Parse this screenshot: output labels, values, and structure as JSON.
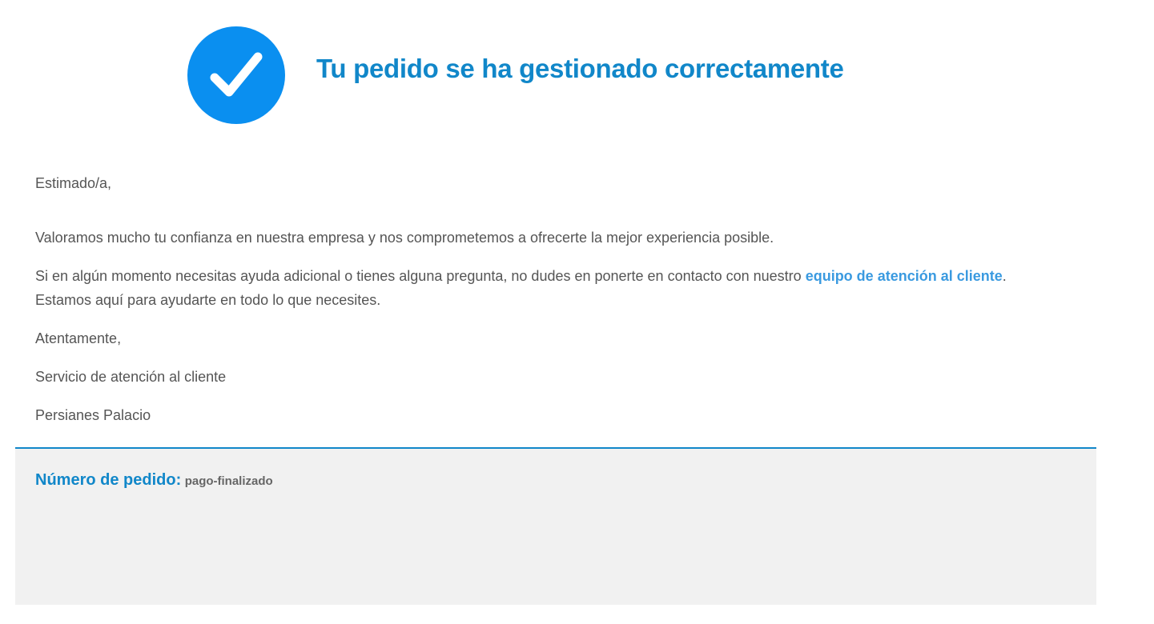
{
  "header": {
    "title": "Tu pedido se ha gestionado correctamente",
    "icon": "check-circle-icon",
    "icon_color": "#0a8ff0",
    "title_color": "#1187c9"
  },
  "message": {
    "greeting": "Estimado/a,",
    "paragraph_1": "Valoramos mucho tu confianza en nuestra empresa y nos comprometemos a ofrecerte la mejor experiencia posible.",
    "paragraph_2_before_link": "Si en algún momento necesitas ayuda adicional o tienes alguna pregunta, no dudes en ponerte en contacto con nuestro ",
    "paragraph_2_link": "equipo de atención al cliente",
    "paragraph_2_after_link": ".",
    "paragraph_2_line_2": "Estamos aquí para ayudarte en todo lo que necesites.",
    "closing": "Atentamente,",
    "signature_department": "Servicio de atención al cliente",
    "signature_company": "Persianes Palacio",
    "link_color": "#3a9ae0"
  },
  "order": {
    "label": "Número de pedido:",
    "value": "pago-finalizado",
    "border_color": "#1187c9",
    "background": "#f1f1f1"
  }
}
